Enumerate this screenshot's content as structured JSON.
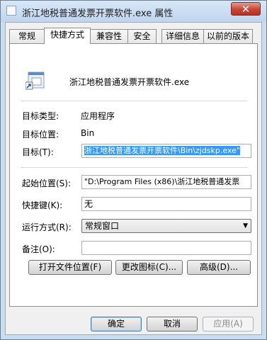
{
  "window": {
    "title": "浙江地税普通发票开票软件.exe 属性",
    "close_glyph": "✕"
  },
  "tabs": [
    {
      "label": "常规"
    },
    {
      "label": "快捷方式"
    },
    {
      "label": "兼容性"
    },
    {
      "label": "安全"
    },
    {
      "label": "详细信息"
    },
    {
      "label": "以前的版本"
    }
  ],
  "shortcut": {
    "file_name": "浙江地税普通发票开票软件.exe",
    "target_type_label": "目标类型:",
    "target_type_value": "应用程序",
    "target_location_label": "目标位置:",
    "target_location_value": "Bin",
    "target_label": "目标(T):",
    "target_value": "浙江地税普通发票开票软件\\Bin\\zjdskp.exe\"",
    "start_in_label": "起始位置(S):",
    "start_in_value": "\"D:\\Program Files (x86)\\浙江地税普通发票",
    "hotkey_label": "快捷键(K):",
    "hotkey_value": "无",
    "run_label": "运行方式(R):",
    "run_value": "常规窗口",
    "comment_label": "备注(O):",
    "comment_value": "",
    "open_location_button": "打开文件位置(F)",
    "change_icon_button": "更改图标(C)...",
    "advanced_button": "高级(D)..."
  },
  "footer": {
    "ok": "确定",
    "cancel": "取消",
    "apply": "应用(A)"
  },
  "colors": {
    "selection": "#3399ff",
    "close_button": "#c74434"
  }
}
